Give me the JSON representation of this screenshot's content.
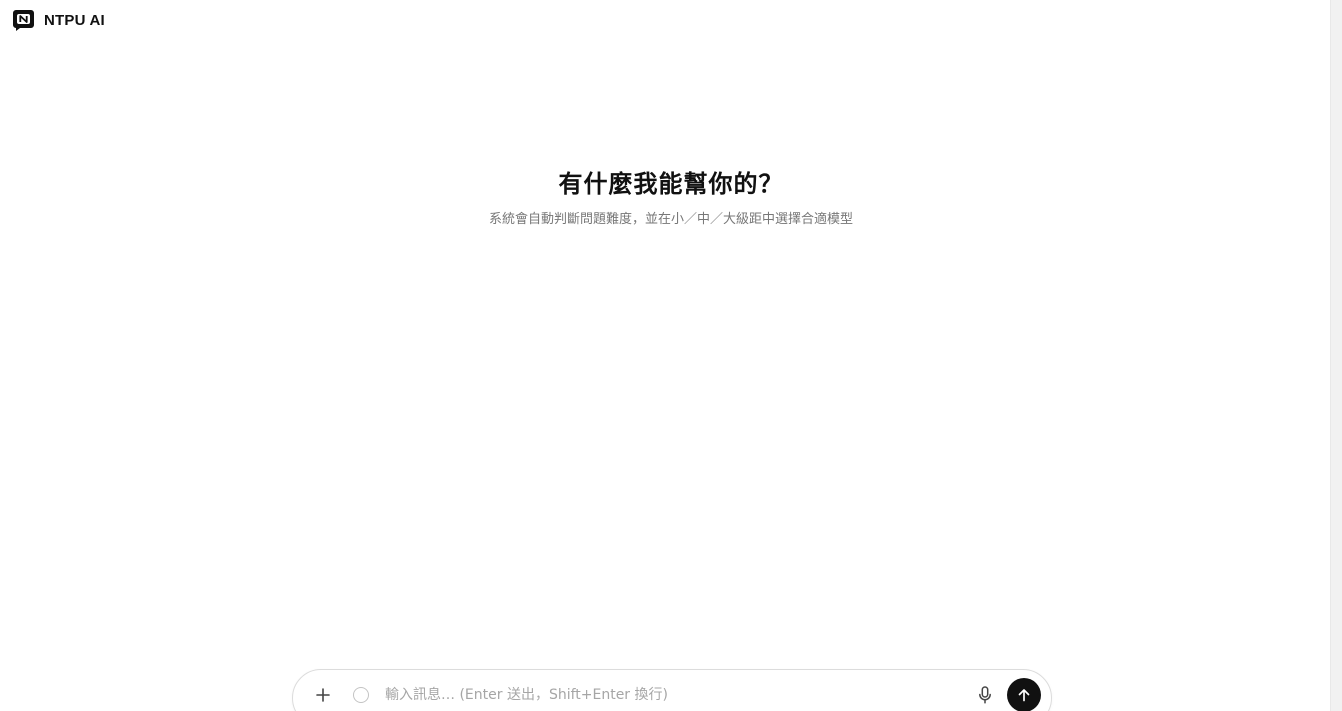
{
  "header": {
    "brand": "NTPU AI",
    "logo_icon": "chat-bubble-n-icon"
  },
  "hero": {
    "title": "有什麼我能幫你的？",
    "subtitle": "系統會自動判斷問題難度，並在小／中／大級距中選擇合適模型"
  },
  "composer": {
    "placeholder": "輸入訊息… (Enter 送出，Shift+Enter 換行)",
    "value": "",
    "attach_icon": "plus-icon",
    "status_icon": "circle-icon",
    "mic_icon": "microphone-icon",
    "send_icon": "arrow-up-icon"
  },
  "colors": {
    "text_primary": "#111111",
    "text_secondary": "#777777",
    "placeholder": "#a6a6a6",
    "send_button": "#111111",
    "border": "#dcdcdc"
  }
}
